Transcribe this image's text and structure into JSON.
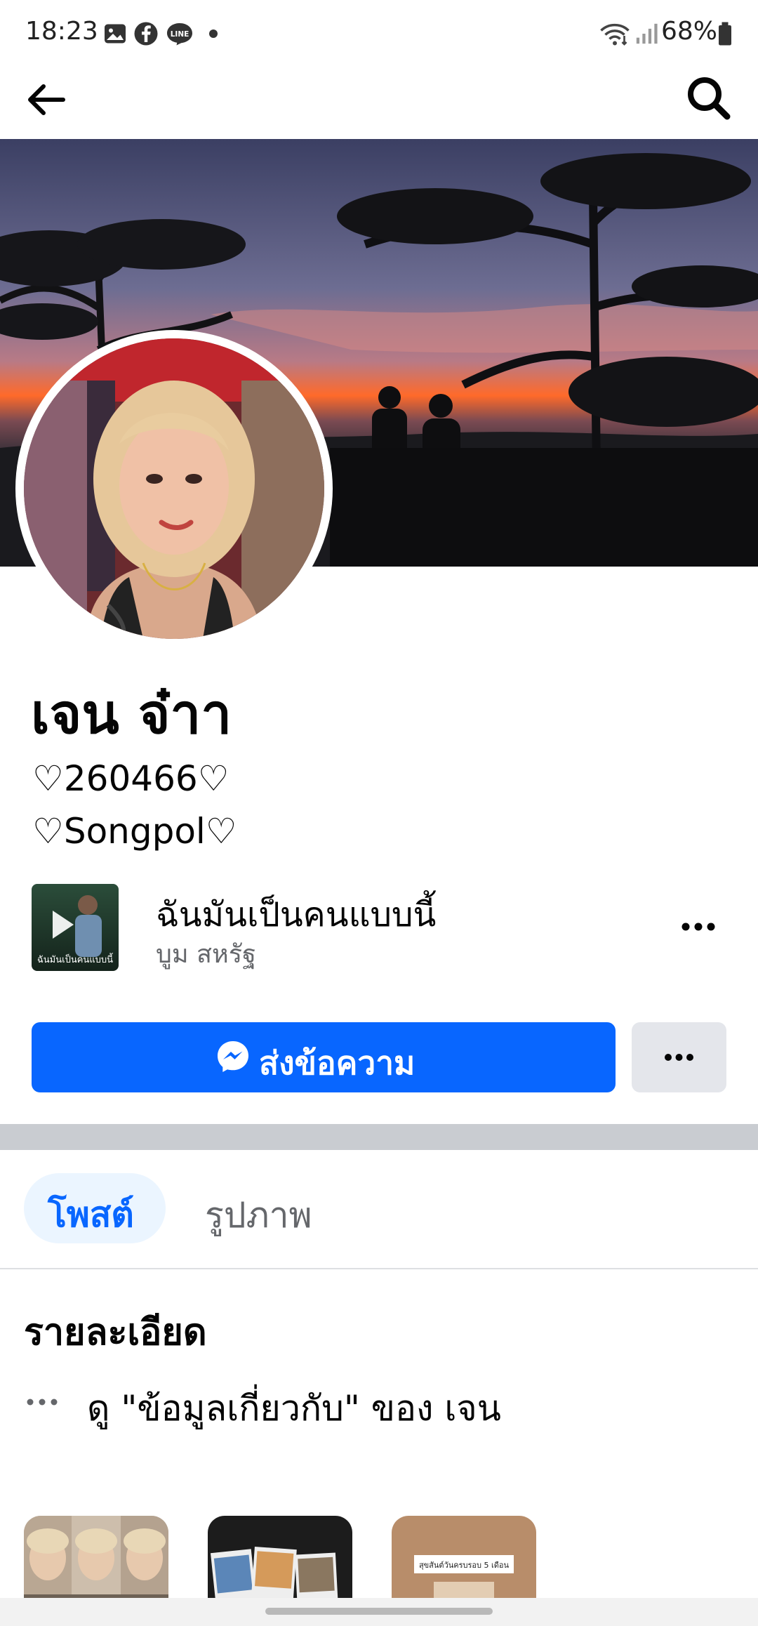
{
  "status_bar": {
    "time": "18:23",
    "battery": "68%",
    "notification_icons": [
      "gallery-icon",
      "facebook-icon",
      "line-icon",
      "dot-icon"
    ],
    "system_icons": [
      "wifi-icon",
      "signal-icon",
      "battery-icon"
    ]
  },
  "profile": {
    "name": "เจน จ๋าา",
    "bio_line1": "♡260466♡",
    "bio_line2": "♡Songpol♡"
  },
  "profile_music": {
    "title": "ฉันมันเป็นคนแบบนี้",
    "artist": "บูม สหรัฐ",
    "thumb_text": "ฉันมันเป็นคนแบบนี้"
  },
  "actions": {
    "message_label": "ส่งข้อความ"
  },
  "tabs": [
    {
      "label": "โพสต์",
      "selected": true
    },
    {
      "label": "รูปภาพ",
      "selected": false
    }
  ],
  "details": {
    "title": "รายละเอียด",
    "about_link": "ดู \"ข้อมูลเกี่ยวกับ\" ของ เจน"
  },
  "featured": {
    "third_caption": "สุขสันต์วันครบรอบ 5 เดือน"
  },
  "colors": {
    "accent": "#0866ff",
    "tab_selected_bg": "#ebf5ff",
    "secondary_button": "#e4e6eb",
    "divider": "#c9ccd1",
    "secondary_text": "#65676b"
  }
}
